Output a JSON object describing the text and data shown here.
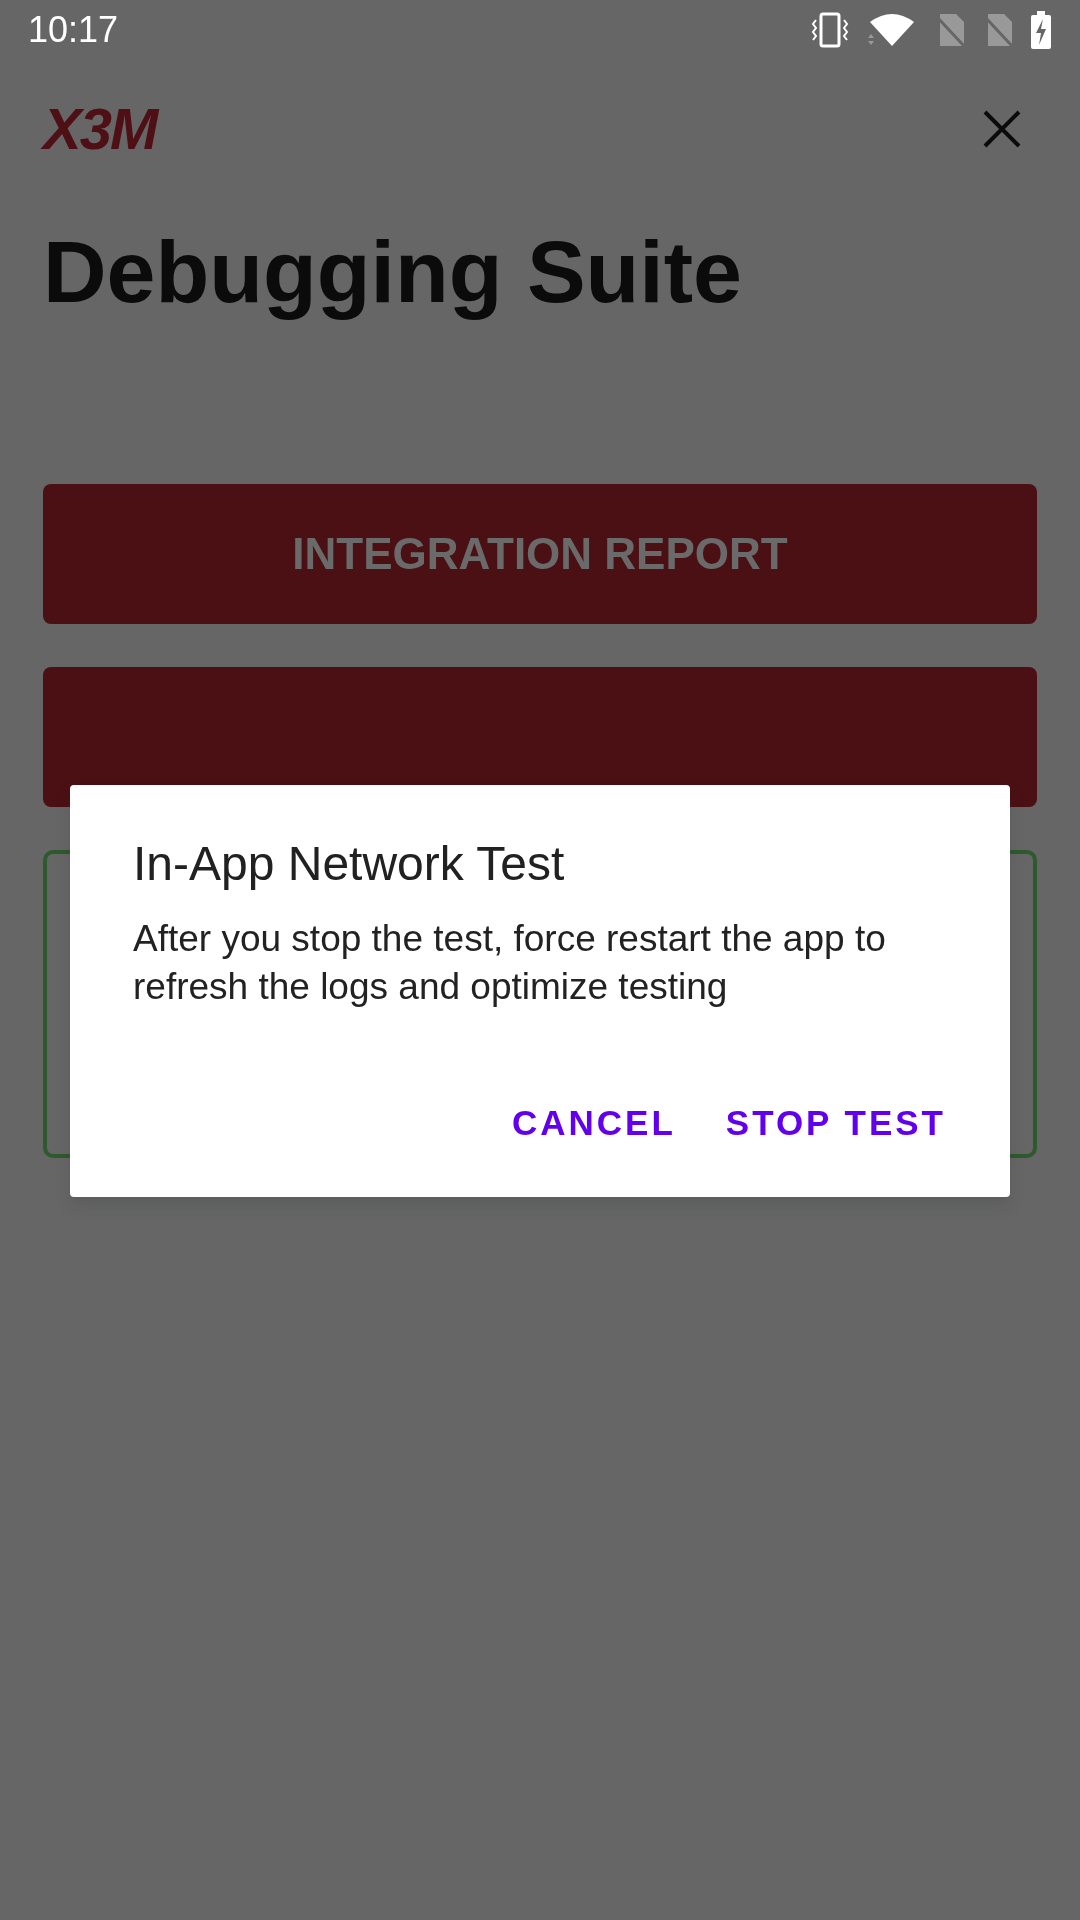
{
  "status_bar": {
    "time": "10:17"
  },
  "header": {
    "logo": "X3M"
  },
  "title": "Debugging Suite",
  "buttons": [
    "INTEGRATION REPORT"
  ],
  "dialog": {
    "title": "In-App Network Test",
    "message": "After you stop the test, force restart the app to refresh the logs and optimize testing",
    "actions": [
      "CANCEL",
      "STOP TEST"
    ]
  }
}
